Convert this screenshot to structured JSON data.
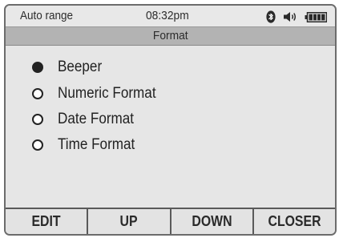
{
  "status_bar": {
    "range_label": "Auto range",
    "time": "08:32pm",
    "icons": [
      "bluetooth-icon",
      "speaker-icon",
      "battery-icon"
    ],
    "battery_level": 1.0
  },
  "screen": {
    "title": "Format"
  },
  "menu": {
    "items": [
      {
        "label": "Beeper",
        "selected": true
      },
      {
        "label": "Numeric Format",
        "selected": false
      },
      {
        "label": "Date Format",
        "selected": false
      },
      {
        "label": "Time Format",
        "selected": false
      }
    ]
  },
  "softkeys": {
    "edit": "EDIT",
    "up": "UP",
    "down": "DOWN",
    "close": "CLOSER"
  },
  "colors": {
    "screen_background": "#e6e6e6",
    "title_bar": "#b3b3b3",
    "text": "#222222"
  }
}
